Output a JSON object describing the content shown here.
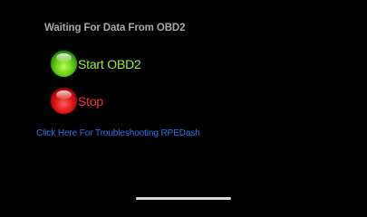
{
  "status": {
    "text": "Waiting For Data From OBD2"
  },
  "buttons": {
    "start_label": "Start OBD2",
    "start_icon": "green-orb-icon",
    "stop_label": "Stop",
    "stop_icon": "red-orb-icon"
  },
  "help": {
    "link_text": "Click Here For Troubleshooting RPEDash"
  },
  "colors": {
    "background": "#000000",
    "status_text": "#a6a6a6",
    "start": "#9dec3a",
    "stop": "#f03232",
    "link": "#2b72e8"
  }
}
